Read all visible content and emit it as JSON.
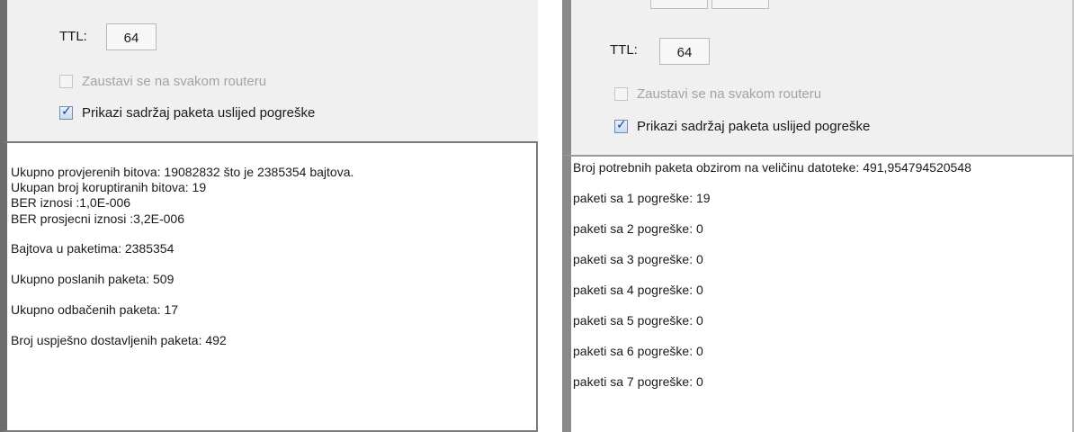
{
  "left": {
    "ttl_label": "TTL:",
    "ttl_value": "64",
    "stop_at_router_label": "Zaustavi se na svakom routeru",
    "show_packet_content_label": "Prikazi sadržaj paketa uslijed pogreške",
    "stop_at_router_checked": false,
    "stop_at_router_enabled": false,
    "show_packet_content_checked": true,
    "output_lines": [
      "Ukupno provjerenih bitova: 19082832 što je 2385354 bajtova.",
      " Ukupan broj koruptiranih bitova: 19",
      "BER iznosi :1,0E-006",
      "BER prosjecni iznosi :3,2E-006",
      "Bajtova u paketima: 2385354",
      "Ukupno poslanih paketa: 509",
      "Ukupno odbačenih paketa: 17",
      "Broj uspješno dostavljenih paketa: 492"
    ]
  },
  "right": {
    "ttl_label": "TTL:",
    "ttl_value": "64",
    "stop_at_router_label": "Zaustavi se na svakom routeru",
    "show_packet_content_label": "Prikazi sadržaj paketa uslijed pogreške",
    "stop_at_router_checked": false,
    "stop_at_router_enabled": false,
    "show_packet_content_checked": true,
    "output_lines": [
      "Broj potrebnih paketa obzirom na veličinu datoteke: 491,954794520548",
      "paketi sa 1 pogreške: 19",
      "paketi sa 2 pogreške: 0",
      "paketi sa 3 pogreške: 0",
      "paketi sa 4 pogreške: 0",
      "paketi sa 5 pogreške: 0",
      "paketi sa 6 pogreške: 0",
      "paketi sa 7 pogreške: 0"
    ]
  }
}
